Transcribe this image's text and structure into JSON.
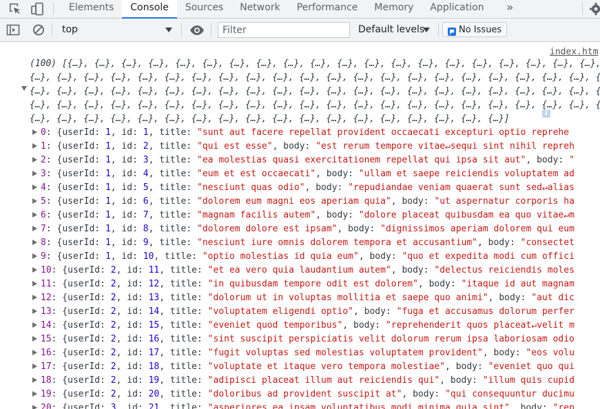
{
  "tabbar": {
    "tabs": [
      {
        "label": "Elements",
        "active": false
      },
      {
        "label": "Console",
        "active": true
      },
      {
        "label": "Sources",
        "active": false
      },
      {
        "label": "Network",
        "active": false
      },
      {
        "label": "Performance",
        "active": false
      },
      {
        "label": "Memory",
        "active": false
      },
      {
        "label": "Application",
        "active": false
      }
    ],
    "more_tabs_glyph": "»",
    "icons": [
      "inspect-element-icon",
      "device-toolbar-icon",
      "settings-gear-icon"
    ]
  },
  "toolbar": {
    "context": "top",
    "filter_placeholder": "Filter",
    "levels_label": "Default levels",
    "issues_label": "No Issues",
    "icons": [
      "sidebar-toggle-icon",
      "clear-console-icon",
      "live-expression-eye-icon",
      "issues-flag-icon"
    ]
  },
  "console": {
    "source_link": "index.htm",
    "summary_lines": [
      "(100) [{…}, {…}, {…}, {…}, {…}, {…}, {…}, {…}, {…}, {…}, {…}, {…}, {…}, {…}, {…}, {…}, {…}, {…}, {…}, {…}, {…},",
      "{…}, {…}, {…}, {…}, {…}, {…}, {…}, {…}, {…}, {…}, {…}, {…}, {…}, {…}, {…}, {…}, {…}, {…}, {…}, {…}, {…}, {…},",
      "{…}, {…}, {…}, {…}, {…}, {…}, {…}, {…}, {…}, {…}, {…}, {…}, {…}, {…}, {…}, {…}, {…}, {…}, {…}, {…}, {…}, {…},",
      "{…}, {…}, {…}, {…}, {…}, {…}, {…}, {…}, {…}, {…}, {…}, {…}, {…}, {…}, {…}, {…}, {…}, {…}, {…}, {…}, {…}, {…},",
      "{…}, {…}, {…}, {…}, {…}, {…}, {…}, {…}, {…}, {…}, {…}, {…}, {…}, {…}, {…}, {…}, {…}, {…}]"
    ],
    "entries": [
      {
        "index": "0",
        "userId": "1",
        "id": "1",
        "title": "\"sunt aut facere repellat provident occaecati excepturi optio reprehe",
        "body": ""
      },
      {
        "index": "1",
        "userId": "1",
        "id": "2",
        "title": "\"qui est esse\"",
        "body": "\"est rerum tempore vitae↵sequi sint nihil repreh"
      },
      {
        "index": "2",
        "userId": "1",
        "id": "3",
        "title": "\"ea molestias quasi exercitationem repellat qui ipsa sit aut\"",
        "body": "\""
      },
      {
        "index": "3",
        "userId": "1",
        "id": "4",
        "title": "\"eum et est occaecati\"",
        "body": "\"ullam et saepe reiciendis voluptatem ad"
      },
      {
        "index": "4",
        "userId": "1",
        "id": "5",
        "title": "\"nesciunt quas odio\"",
        "body": "\"repudiandae veniam quaerat sunt sed↵alias"
      },
      {
        "index": "5",
        "userId": "1",
        "id": "6",
        "title": "\"dolorem eum magni eos aperiam quia\"",
        "body": "\"ut aspernatur corporis ha"
      },
      {
        "index": "6",
        "userId": "1",
        "id": "7",
        "title": "\"magnam facilis autem\"",
        "body": "\"dolore placeat quibusdam ea quo vitae↵m"
      },
      {
        "index": "7",
        "userId": "1",
        "id": "8",
        "title": "\"dolorem dolore est ipsam\"",
        "body": "\"dignissimos aperiam dolorem qui eum"
      },
      {
        "index": "8",
        "userId": "1",
        "id": "9",
        "title": "\"nesciunt iure omnis dolorem tempora et accusantium\"",
        "body": "\"consectet"
      },
      {
        "index": "9",
        "userId": "1",
        "id": "10",
        "title": "\"optio molestias id quia eum\"",
        "body": "\"quo et expedita modi cum offici"
      },
      {
        "index": "10",
        "userId": "2",
        "id": "11",
        "title": "\"et ea vero quia laudantium autem\"",
        "body": "\"delectus reiciendis moles"
      },
      {
        "index": "11",
        "userId": "2",
        "id": "12",
        "title": "\"in quibusdam tempore odit est dolorem\"",
        "body": "\"itaque id aut magnam"
      },
      {
        "index": "12",
        "userId": "2",
        "id": "13",
        "title": "\"dolorum ut in voluptas mollitia et saepe quo animi\"",
        "body": "\"aut dic"
      },
      {
        "index": "13",
        "userId": "2",
        "id": "14",
        "title": "\"voluptatem eligendi optio\"",
        "body": "\"fuga et accusamus dolorum perfer"
      },
      {
        "index": "14",
        "userId": "2",
        "id": "15",
        "title": "\"eveniet quod temporibus\"",
        "body": "\"reprehenderit quos placeat↵velit m"
      },
      {
        "index": "15",
        "userId": "2",
        "id": "16",
        "title": "\"sint suscipit perspiciatis velit dolorum rerum ipsa laboriosam odio"
      },
      {
        "index": "16",
        "userId": "2",
        "id": "17",
        "title": "\"fugit voluptas sed molestias voluptatem provident\"",
        "body": "\"eos volu"
      },
      {
        "index": "17",
        "userId": "2",
        "id": "18",
        "title": "\"voluptate et itaque vero tempora molestiae\"",
        "body": "\"eveniet quo qui"
      },
      {
        "index": "18",
        "userId": "2",
        "id": "19",
        "title": "\"adipisci placeat illum aut reiciendis qui\"",
        "body": "\"illum quis cupid"
      },
      {
        "index": "19",
        "userId": "2",
        "id": "20",
        "title": "\"doloribus ad provident suscipit at\"",
        "body": "\"qui consequuntur ducimu"
      },
      {
        "index": "20",
        "userId": "3",
        "id": "21",
        "title": "\"asperiores ea ipsam voluptatibus modi minima quia sint\"",
        "body": "\"rep"
      }
    ]
  },
  "colors": {
    "index": "#881391",
    "number": "#1c00cf",
    "string": "#c41a16",
    "accent": "#1a73e8"
  }
}
